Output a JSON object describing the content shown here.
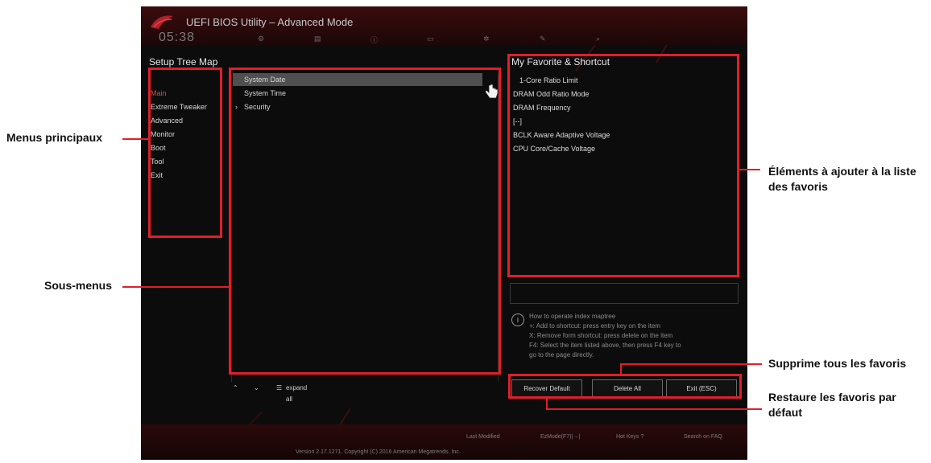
{
  "bios": {
    "title": "UEFI BIOS Utility – Advanced Mode",
    "clock": "05:38",
    "top_items": [
      "Setup Tree Map"
    ],
    "menus_title": "Setup Tree Map",
    "main_menus": [
      "Main",
      "Extreme Tweaker",
      "Advanced",
      "Monitor",
      "Boot",
      "Tool",
      "Exit"
    ],
    "submenus": [
      {
        "label": "System Date",
        "selected": true,
        "bullet": ""
      },
      {
        "label": "System Time",
        "selected": false,
        "bullet": ""
      },
      {
        "label": "Security",
        "selected": false,
        "bullet": "›"
      }
    ],
    "controls": {
      "collapse": "⌃",
      "expand": "⌄",
      "expand_all": "expand all"
    },
    "favorites_title": "My Favorite & Shortcut",
    "favorites": [
      "1-Core Ratio Limit",
      "DRAM Odd Ratio Mode",
      "DRAM Frequency",
      "[--]",
      "BCLK Aware Adaptive Voltage",
      "CPU Core/Cache Voltage"
    ],
    "info_lines": [
      "How to operate index maptree",
      "+: Add to shortcut: press entry key on the item",
      "X: Remove form shortcut: press delete on the item",
      "F4: Select the item listed above, then press F4 key to",
      "go to the page directly."
    ],
    "buttons": {
      "recover": "Recover Default",
      "delete": "Delete All",
      "exit": "Exit (ESC)"
    },
    "footer": {
      "last_modified": "Last Modified",
      "ezmode": "EzMode(F7)|→|",
      "hotkeys": "Hot Keys ?",
      "search": "Search on FAQ",
      "version": "Version 2.17.1271. Copyright (C) 2016 American Megatrends, Inc."
    }
  },
  "annotations": {
    "main_menus": "Menus principaux",
    "submenus": "Sous-menus",
    "favorites_line1": "Éléments à ajouter à la liste",
    "favorites_line2": "des favoris",
    "delete_all": "Supprime tous les favoris",
    "recover_line1": "Restaure les favoris par",
    "recover_line2": "défaut"
  },
  "colors": {
    "highlight": "#e01f2a",
    "selected_row": "#4f4f4f"
  }
}
